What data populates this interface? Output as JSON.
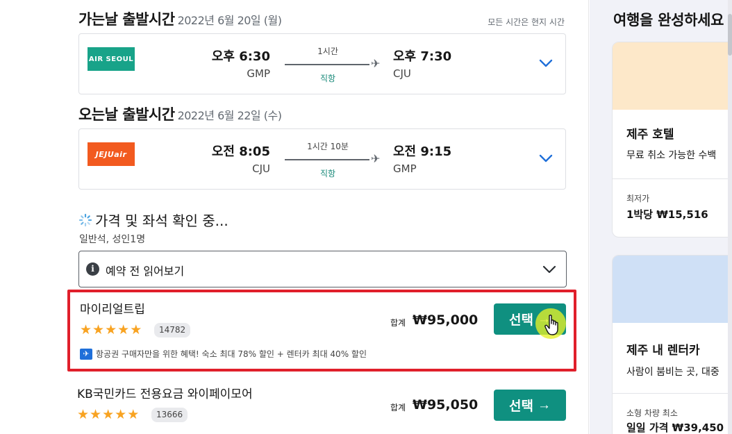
{
  "outbound": {
    "title": "가는날 출발시간",
    "date": "2022년 6월 20일 (월)",
    "timezone_note": "모든 시간은 현지 시간",
    "airline": "AIR SEOUL",
    "dep_time": "오후 6:30",
    "dep_code": "GMP",
    "duration": "1시간",
    "stops": "직항",
    "arr_time": "오후 7:30",
    "arr_code": "CJU"
  },
  "inbound": {
    "title": "오는날 출발시간",
    "date": "2022년 6월 22일 (수)",
    "airline": "JEJUair",
    "dep_time": "오전 8:05",
    "dep_code": "CJU",
    "duration": "1시간 10분",
    "stops": "직항",
    "arr_time": "오전 9:15",
    "arr_code": "GMP"
  },
  "checking": {
    "label": "가격 및 좌석 확인 중...",
    "cabin": "일반석, 성인1명"
  },
  "accordion": {
    "label": "예약 전 읽어보기"
  },
  "offers": [
    {
      "provider": "마이리얼트립",
      "stars": 5,
      "reviews": "14782",
      "total_label": "합계",
      "price": "₩95,000",
      "button": "선택",
      "perk": "항공권 구매자만을 위한 혜택! 숙소 최대 78% 할인 + 렌터카 최대 40% 할인"
    },
    {
      "provider": "KB국민카드 전용요금 와이페이모어",
      "stars": 5,
      "reviews": "13666",
      "total_label": "합계",
      "price": "₩95,050",
      "button": "선택"
    }
  ],
  "side_panel": {
    "title": "여행을 완성하세요",
    "cards": [
      {
        "name": "제주 호텔",
        "desc": "무료 취소 가능한 수백",
        "price_label": "최저가",
        "price": "1박당 ₩15,516",
        "banner_color": "#fde8c9"
      },
      {
        "name": "제주 내 렌터카",
        "desc": "사람이 붐비는 곳, 대중",
        "price_label": "소형 차량 최소",
        "price": "일일 가격 ₩39,450",
        "banner_color": "#cfe0f6"
      }
    ]
  },
  "colors": {
    "accent": "#0f9080",
    "highlight_border": "#e01f2b",
    "star": "#f8a322",
    "air_seoul": "#18a389",
    "jeju_air": "#f25a1f"
  }
}
